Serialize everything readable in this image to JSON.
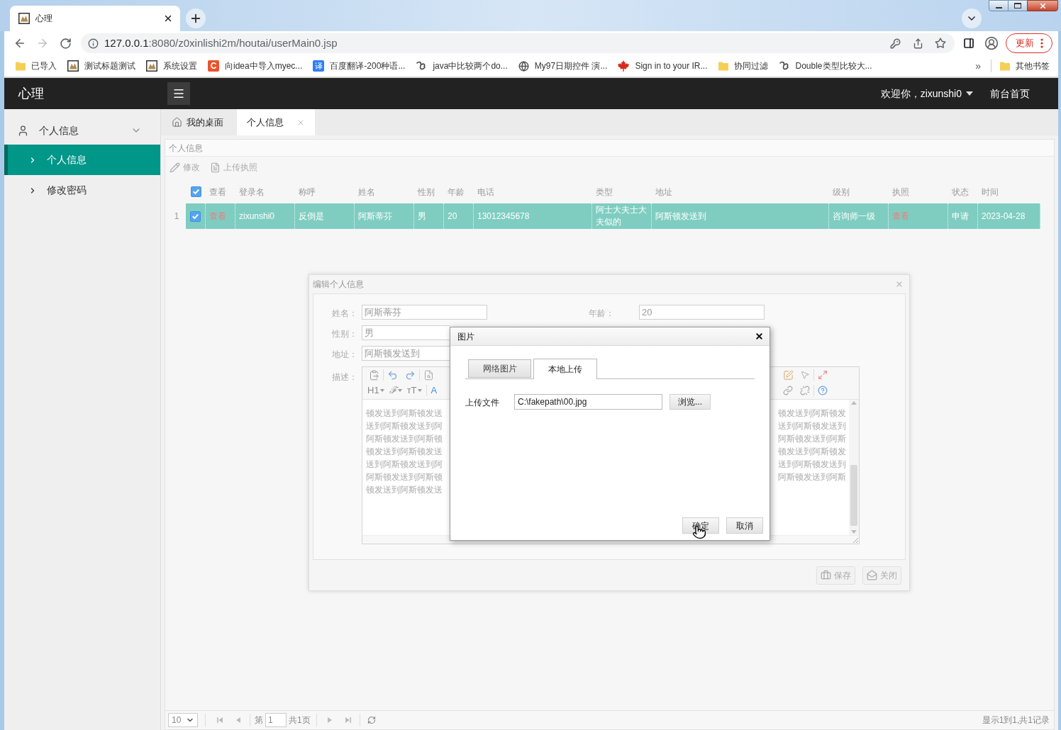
{
  "browser": {
    "tab": {
      "title": "心理"
    },
    "forward_disabled": true,
    "address": {
      "host": "127.0.0.1",
      "path": ":8080/z0xinlishi2m/houtai/userMain0.jsp"
    },
    "update_button": "更新",
    "bookmarks": [
      {
        "label": "已导入",
        "kind": "folder"
      },
      {
        "label": "测试标题测试",
        "kind": "site"
      },
      {
        "label": "系统设置",
        "kind": "site"
      },
      {
        "label": "向idea中导入myec...",
        "kind": "letter",
        "glyph": "C"
      },
      {
        "label": "百度翻译-200种语...",
        "kind": "translate",
        "glyph": "译"
      },
      {
        "label": "java中比较两个do...",
        "kind": "script"
      },
      {
        "label": "My97日期控件 演...",
        "kind": "globe"
      },
      {
        "label": "Sign in to your IR...",
        "kind": "leaf"
      },
      {
        "label": "协同过滤",
        "kind": "folder"
      },
      {
        "label": "Double类型比较大...",
        "kind": "script"
      }
    ],
    "overflow": "»",
    "other_bookmarks": {
      "label": "其他书签",
      "kind": "folder"
    }
  },
  "header": {
    "logo": "心理",
    "welcome": "欢迎你，zixunshi0",
    "home_link": "前台首页"
  },
  "sidebar": {
    "groups": [
      {
        "label": "个人信息",
        "expanded": true,
        "children": [
          {
            "label": "个人信息",
            "selected": true
          },
          {
            "label": "修改密码",
            "selected": false
          }
        ]
      }
    ]
  },
  "tabs": [
    {
      "label": "我的桌面",
      "kind": "home",
      "selected": false
    },
    {
      "label": "个人信息",
      "kind": "closable",
      "selected": true
    }
  ],
  "panel": {
    "title": "个人信息",
    "toolbar": [
      {
        "label": "修改",
        "kind": "edit"
      },
      {
        "label": "上传执照",
        "kind": "upload"
      }
    ],
    "table": {
      "all_checked": true,
      "columns": [
        "查看",
        "登录名",
        "称呼",
        "姓名",
        "性别",
        "年龄",
        "电话",
        "类型",
        "地址",
        "级别",
        "执照",
        "状态",
        "时间"
      ],
      "rows": [
        {
          "number": "1",
          "checked": true,
          "selected": true,
          "cells": [
            {
              "text": "查看",
              "kind": "link"
            },
            {
              "text": "zixunshi0",
              "kind": "text"
            },
            {
              "text": "反倒是",
              "kind": "text"
            },
            {
              "text": "阿斯蒂芬",
              "kind": "text"
            },
            {
              "text": "男",
              "kind": "text"
            },
            {
              "text": "20",
              "kind": "text"
            },
            {
              "text": "13012345678",
              "kind": "text"
            },
            {
              "text": "阿士大夫士大夫似的",
              "kind": "text"
            },
            {
              "text": "阿斯顿发送到",
              "kind": "text"
            },
            {
              "text": "咨询师一级",
              "kind": "text"
            },
            {
              "text": "查看",
              "kind": "link"
            },
            {
              "text": "申请",
              "kind": "text"
            },
            {
              "text": "2023-04-28",
              "kind": "text"
            }
          ]
        }
      ]
    },
    "pager": {
      "page_size": "10",
      "page_prefix": "第",
      "page": "1",
      "page_total": "共1页",
      "summary": "显示1到1,共1记录"
    }
  },
  "edit_dialog": {
    "title": "编辑个人信息",
    "rows": [
      {
        "fields": [
          {
            "label": "姓名：",
            "value": "阿斯蒂芬"
          },
          {
            "label": "年龄：",
            "value": "20"
          }
        ]
      },
      {
        "fields": [
          {
            "label": "性别：",
            "value": "男"
          }
        ]
      },
      {
        "fields": [
          {
            "label": "地址：",
            "value": "阿斯顿发送到"
          }
        ]
      }
    ],
    "description_label": "描述：",
    "editor": {
      "text_buttons": [
        {
          "label": "H1",
          "kind": "heading"
        },
        {
          "label": "ℱ",
          "kind": "font"
        },
        {
          "label": "тT",
          "kind": "size"
        },
        {
          "label": "A",
          "kind": "color"
        }
      ],
      "lines": [
        {
          "left": "顿发送到阿斯顿发送",
          "right": "顿发送到阿斯顿发"
        },
        {
          "left": "送到阿斯顿发送到阿",
          "right": "送到阿斯顿发送到"
        },
        {
          "left": "阿斯顿发送到阿斯顿",
          "right": "阿斯顿发送到阿斯"
        },
        {
          "left": "顿发送到阿斯顿发送",
          "right": "顿发送到阿斯顿发"
        },
        {
          "left": "送到阿斯顿发送到阿",
          "right": "送到阿斯顿发送到"
        },
        {
          "left": "阿斯顿发送到阿斯顿",
          "right": "阿斯顿发送到阿斯"
        },
        {
          "left": "顿发送到阿斯顿发送"
        }
      ]
    },
    "buttons": [
      {
        "label": "保存",
        "kind": "save"
      },
      {
        "label": "关闭",
        "kind": "close"
      }
    ]
  },
  "image_dialog": {
    "title": "图片",
    "tabs": [
      {
        "label": "网络图片",
        "selected": false
      },
      {
        "label": "本地上传",
        "selected": true
      }
    ],
    "file_label": "上传文件",
    "file_value": "C:\\fakepath\\00.jpg",
    "browse_button": "浏览...",
    "buttons": [
      "确定",
      "取消"
    ]
  }
}
